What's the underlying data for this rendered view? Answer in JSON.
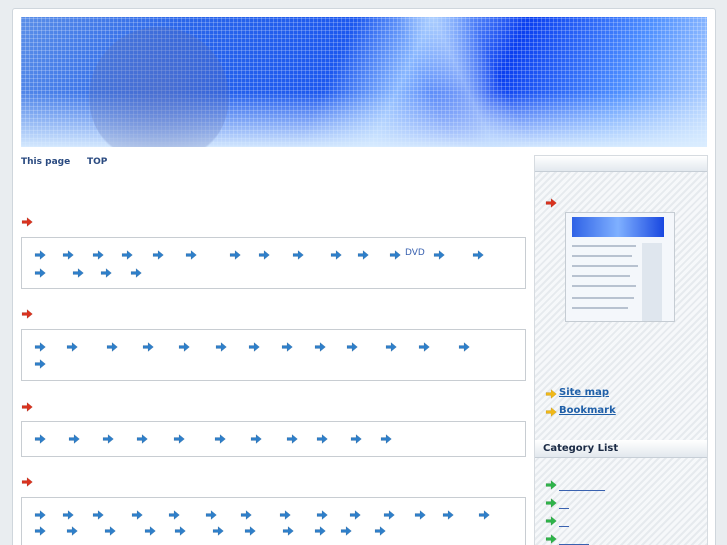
{
  "nav": {
    "this_page": "This page",
    "top": "TOP"
  },
  "section2": {
    "dvd_label": "DVD"
  },
  "sidebar": {
    "links": [
      {
        "label": "Site map"
      },
      {
        "label": "Bookmark"
      }
    ],
    "category_title": "Category List"
  },
  "colors": {
    "accent_red_arrow": "#d9331f",
    "blue_arrow": "#2f7fc9",
    "yellow_arrow": "#f0b818",
    "green_arrow": "#2fb44a",
    "link": "#1f5fa8"
  }
}
